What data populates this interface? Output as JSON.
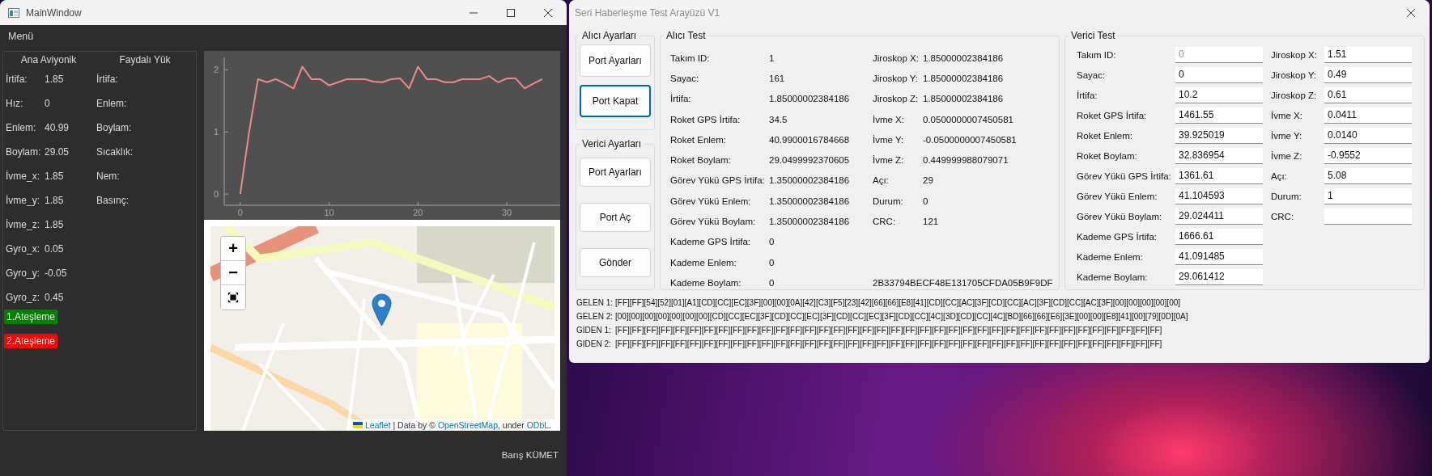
{
  "main_window": {
    "title": "MainWindow",
    "menu": [
      "Menü"
    ],
    "avionics": {
      "title": "Ana Aviyonik",
      "rows": [
        {
          "label": "İrtifa:",
          "value": "1.85"
        },
        {
          "label": "Hız:",
          "value": "0"
        },
        {
          "label": "Enlem:",
          "value": "40.99"
        },
        {
          "label": "Boylam:",
          "value": "29.05"
        },
        {
          "label": "İvme_x:",
          "value": "1.85"
        },
        {
          "label": "İvme_y:",
          "value": "1.85"
        },
        {
          "label": "İvme_z:",
          "value": "1.85"
        },
        {
          "label": "Gyro_x:",
          "value": "0.05"
        },
        {
          "label": "Gyro_y:",
          "value": "-0.05"
        },
        {
          "label": "Gyro_z:",
          "value": "0.45"
        }
      ]
    },
    "payload": {
      "title": "Faydalı Yük",
      "rows": [
        {
          "label": "İrtifa:"
        },
        {
          "label": "Enlem:"
        },
        {
          "label": "Boylam:"
        },
        {
          "label": "Sıcaklık:"
        },
        {
          "label": "Nem:"
        },
        {
          "label": "Basınç:"
        }
      ]
    },
    "ignition_buttons": [
      {
        "label": "1.Ateşleme",
        "color": "#008000"
      },
      {
        "label": "2.Ateşleme",
        "color": "#ff0000"
      }
    ],
    "chart": {
      "chart_data": {
        "type": "line",
        "x": [
          0,
          1,
          2,
          3,
          4,
          5,
          6,
          7,
          8,
          9,
          10,
          11,
          12,
          13,
          14,
          15,
          16,
          17,
          18,
          19,
          20,
          21,
          22,
          23,
          24,
          25,
          26,
          27,
          28,
          29,
          30,
          31,
          32,
          33,
          34
        ],
        "series": [
          {
            "color": "#f08a8a",
            "values": [
              0,
              1.0,
              1.85,
              1.8,
              1.85,
              1.78,
              1.7,
              2.05,
              1.85,
              1.85,
              1.75,
              1.8,
              1.85,
              1.85,
              1.85,
              1.81,
              1.8,
              1.85,
              1.86,
              1.7,
              2.05,
              1.85,
              1.85,
              1.8,
              1.8,
              1.85,
              1.85,
              1.85,
              1.9,
              1.8,
              1.86,
              1.86,
              1.7,
              1.78,
              1.85
            ]
          }
        ],
        "xlim": [
          -1.8,
          36
        ],
        "ylim": [
          -0.18,
          2.2
        ],
        "xticks": [
          0,
          10,
          20,
          30
        ],
        "yticks": [
          0,
          1,
          2
        ]
      }
    },
    "map": {
      "zoom_in": "+",
      "zoom_out": "−",
      "attribution": [
        {
          "kind": "link",
          "text": "Leaflet"
        },
        {
          "kind": "text",
          "text": " | Data by © "
        },
        {
          "kind": "link",
          "text": "OpenStreetMap"
        },
        {
          "kind": "text",
          "text": ", under "
        },
        {
          "kind": "link",
          "text": "ODbL"
        },
        {
          "kind": "text",
          "text": "."
        }
      ]
    },
    "footer": "Barış KÜMET"
  },
  "serial_window": {
    "title": "Seri Haberleşme Test Arayüzü V1",
    "receiver_settings": {
      "title": "Alıcı Ayarları",
      "buttons": [
        {
          "label": "Port Ayarları",
          "focused": false
        },
        {
          "label": "Port Kapat",
          "focused": true
        }
      ]
    },
    "transmitter_settings": {
      "title": "Verici Ayarları",
      "buttons": [
        {
          "label": "Port Ayarları",
          "focused": false
        },
        {
          "label": "Port Aç",
          "focused": false
        },
        {
          "label": "Gönder",
          "focused": false
        }
      ]
    },
    "receiver_test": {
      "title": "Alıcı Test",
      "left": [
        {
          "label": "Takım ID:",
          "value": "1"
        },
        {
          "label": "Sayac:",
          "value": "161"
        },
        {
          "label": "İrtifa:",
          "value": "1.85000002384186"
        },
        {
          "label": "Roket GPS İrtifa:",
          "value": "34.5"
        },
        {
          "label": "Roket Enlem:",
          "value": "40.9900016784668"
        },
        {
          "label": "Roket Boylam:",
          "value": "29.0499992370605"
        },
        {
          "label": "Görev Yükü GPS İrtifa:",
          "value": "1.35000002384186"
        },
        {
          "label": "Görev Yükü Enlem:",
          "value": "1.35000002384186"
        },
        {
          "label": "Görev Yükü Boylam:",
          "value": "1.35000002384186"
        },
        {
          "label": "Kademe GPS İrtifa:",
          "value": "0"
        },
        {
          "label": "Kademe Enlem:",
          "value": "0"
        },
        {
          "label": "Kademe Boylam:",
          "value": "0"
        }
      ],
      "right": [
        {
          "label": "Jiroskop X:",
          "value": "1.85000002384186"
        },
        {
          "label": "Jiroskop Y:",
          "value": "1.85000002384186"
        },
        {
          "label": "Jiroskop Z:",
          "value": "1.85000002384186"
        },
        {
          "label": "İvme X:",
          "value": "0.0500000007450581"
        },
        {
          "label": "İvme Y:",
          "value": "-0.0500000007450581"
        },
        {
          "label": "İvme Z:",
          "value": "0.449999988079071"
        },
        {
          "label": "Açı:",
          "value": "29"
        },
        {
          "label": "Durum:",
          "value": "0"
        },
        {
          "label": "CRC:",
          "value": "121"
        }
      ],
      "checksum": "2B33794BECF48E131705CFDA05B9F9DF"
    },
    "transmitter_test": {
      "title": "Verici Test",
      "left": [
        {
          "label": "Takım ID:",
          "placeholder": "0"
        },
        {
          "label": "Sayac:",
          "value": "0"
        },
        {
          "label": "İrtifa:",
          "value": "10.2"
        },
        {
          "label": "Roket GPS İrtifa:",
          "value": "1461.55"
        },
        {
          "label": "Roket Enlem:",
          "value": "39.925019"
        },
        {
          "label": "Roket Boylam:",
          "value": "32.836954"
        },
        {
          "label": "Görev Yükü GPS İrtifa:",
          "value": "1361.61"
        },
        {
          "label": "Görev Yükü Enlem:",
          "value": "41.104593"
        },
        {
          "label": "Görev Yükü Boylam:",
          "value": "29.024411"
        },
        {
          "label": "Kademe GPS İrtifa:",
          "value": "1666.61"
        },
        {
          "label": "Kademe Enlem:",
          "value": "41.091485"
        },
        {
          "label": "Kademe Boylam:",
          "value": "29.061412"
        }
      ],
      "right": [
        {
          "label": "Jiroskop X:",
          "value": "1.51"
        },
        {
          "label": "Jiroskop Y:",
          "value": "0.49"
        },
        {
          "label": "Jiroskop Z:",
          "value": "0.61"
        },
        {
          "label": "İvme X:",
          "value": "0.0411"
        },
        {
          "label": "İvme Y:",
          "value": "0.0140"
        },
        {
          "label": "İvme Z:",
          "value": "-0.9552"
        },
        {
          "label": "Açı:",
          "value": "5.08"
        },
        {
          "label": "Durum:",
          "value": "1"
        },
        {
          "label": "CRC:"
        }
      ]
    },
    "traffic_lines": [
      {
        "label": "GELEN 1:",
        "bytes": "[FF][FF][54][52][01][A1][CD][CC][EC][3F][00][00][0A][42][C3][F5][23][42][66][66][E8][41][CD][CC][AC][3F][CD][CC][AC][3F][CD][CC][AC][3F][00][00][00][00][00]"
      },
      {
        "label": "GELEN 2:",
        "bytes": "[00][00][00][00][00][00][00][CD][CC][EC][3F][CD][CC][EC][3F][CD][CC][EC][3F][CD][CC][4C][3D][CD][CC][4C][BD][66][66][E6][3E][00][00][E8][41][00][79][0D][0A]"
      },
      {
        "label": "GIDEN 1:",
        "bytes": "[FF][FF][FF][FF][FF][FF][FF][FF][FF][FF][FF][FF][FF][FF][FF][FF][FF][FF][FF][FF][FF][FF][FF][FF][FF][FF][FF][FF][FF][FF][FF][FF][FF][FF][FF][FF][FF][FF]"
      },
      {
        "label": "GIDEN 2:",
        "bytes": "[FF][FF][FF][FF][FF][FF][FF][FF][FF][FF][FF][FF][FF][FF][FF][FF][FF][FF][FF][FF][FF][FF][FF][FF][FF][FF][FF][FF][FF][FF][FF][FF][FF][FF][FF][FF][FF][FF]"
      }
    ]
  }
}
